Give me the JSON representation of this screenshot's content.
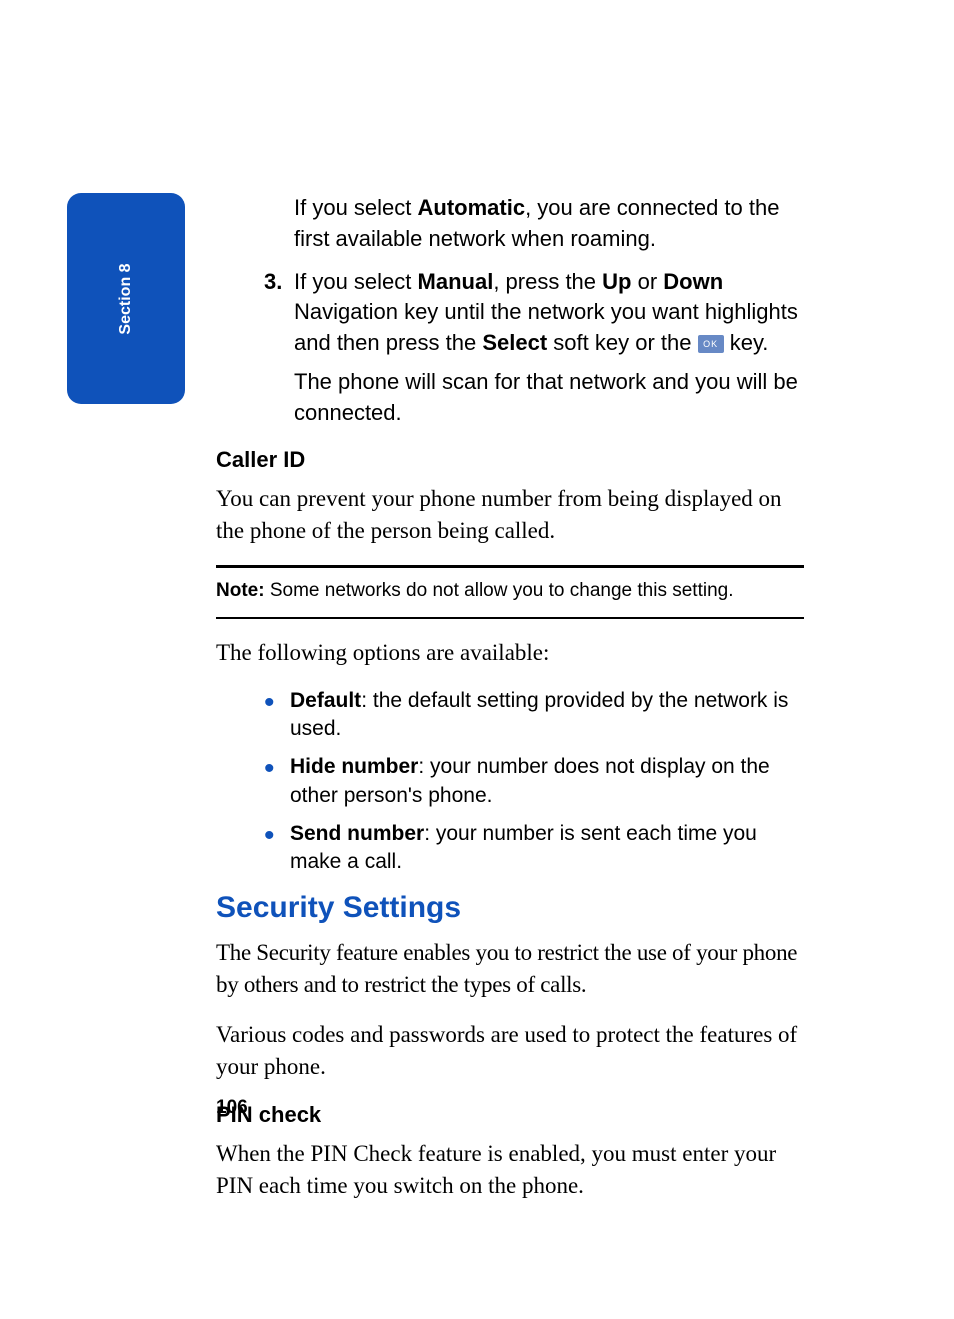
{
  "tab": {
    "label": "Section 8"
  },
  "intro": {
    "auto_pre": "If you select ",
    "auto_bold": "Automatic",
    "auto_post": ", you are connected to the first available network when roaming."
  },
  "step3": {
    "num": "3.",
    "seg1": "If you select ",
    "b1": "Manual",
    "seg2": ", press the ",
    "b2": "Up",
    "seg3": " or ",
    "b3": "Down",
    "seg4": " Navigation key until the network you want highlights and then press the ",
    "b4": "Select",
    "seg5": " soft key or the ",
    "ok": "OK",
    "seg6": " key.",
    "follow": "The phone will scan for that network and you will be connected."
  },
  "callerId": {
    "heading": "Caller ID",
    "body": "You can prevent your phone number from being displayed on the phone of the person being called."
  },
  "note": {
    "label": "Note:",
    "text": " Some networks do not allow you to change this setting."
  },
  "optionsIntro": "The following options are available:",
  "bullets": [
    {
      "bold": "Default",
      "rest": ": the default setting provided by the network is used."
    },
    {
      "bold": "Hide number",
      "rest": ": your number does not display on the other person's phone."
    },
    {
      "bold": "Send number",
      "rest": ": your number is sent each time you make a call."
    }
  ],
  "security": {
    "heading": "Security Settings",
    "p1": "The Security feature enables you to restrict the use of your phone by others and to restrict the types of calls.",
    "p2": "Various codes and passwords are used to protect the features of your phone."
  },
  "pin": {
    "heading": "PIN check",
    "body": "When the PIN Check feature is enabled, you must enter your PIN each time you switch on the phone."
  },
  "pageNumber": "106"
}
